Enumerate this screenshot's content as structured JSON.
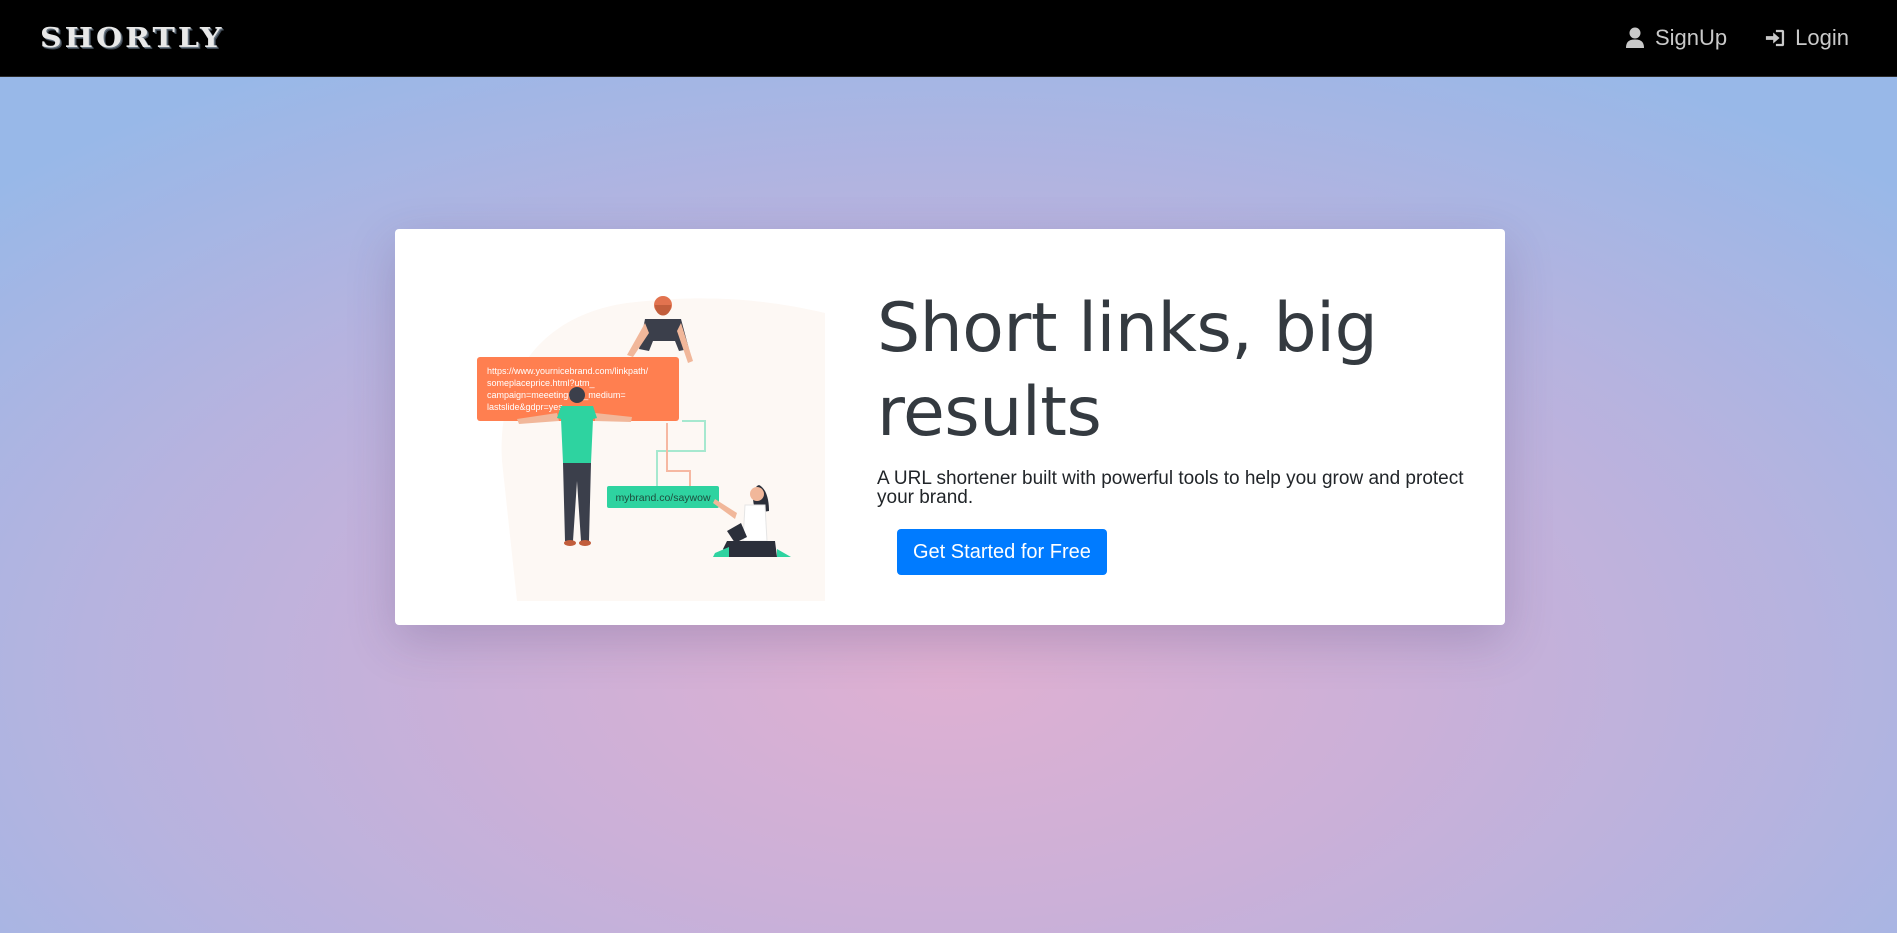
{
  "nav": {
    "brand": "SHORTLY",
    "signup_label": "SignUp",
    "login_label": "Login",
    "signup_icon": "user-icon",
    "login_icon": "sign-in-icon"
  },
  "hero": {
    "headline": "Short links, big results",
    "subtext": "A URL shortener built with powerful tools to help you grow and protect your brand.",
    "cta_label": "Get Started for Free"
  },
  "illustration": {
    "long_url_lines": [
      "https://www.yournicebrand.com/linkpath/",
      "someplaceprice.html?utm_",
      "campaign=meeetingutm_medium=",
      "lastslide&gdpr=yes"
    ],
    "short_url": "mybrand.co/saywow"
  },
  "colors": {
    "navbar": "#000000",
    "accent": "#007bff",
    "orange_card": "#ff7f50",
    "teal_card": "#2ed3a0",
    "headline": "#343a40"
  }
}
